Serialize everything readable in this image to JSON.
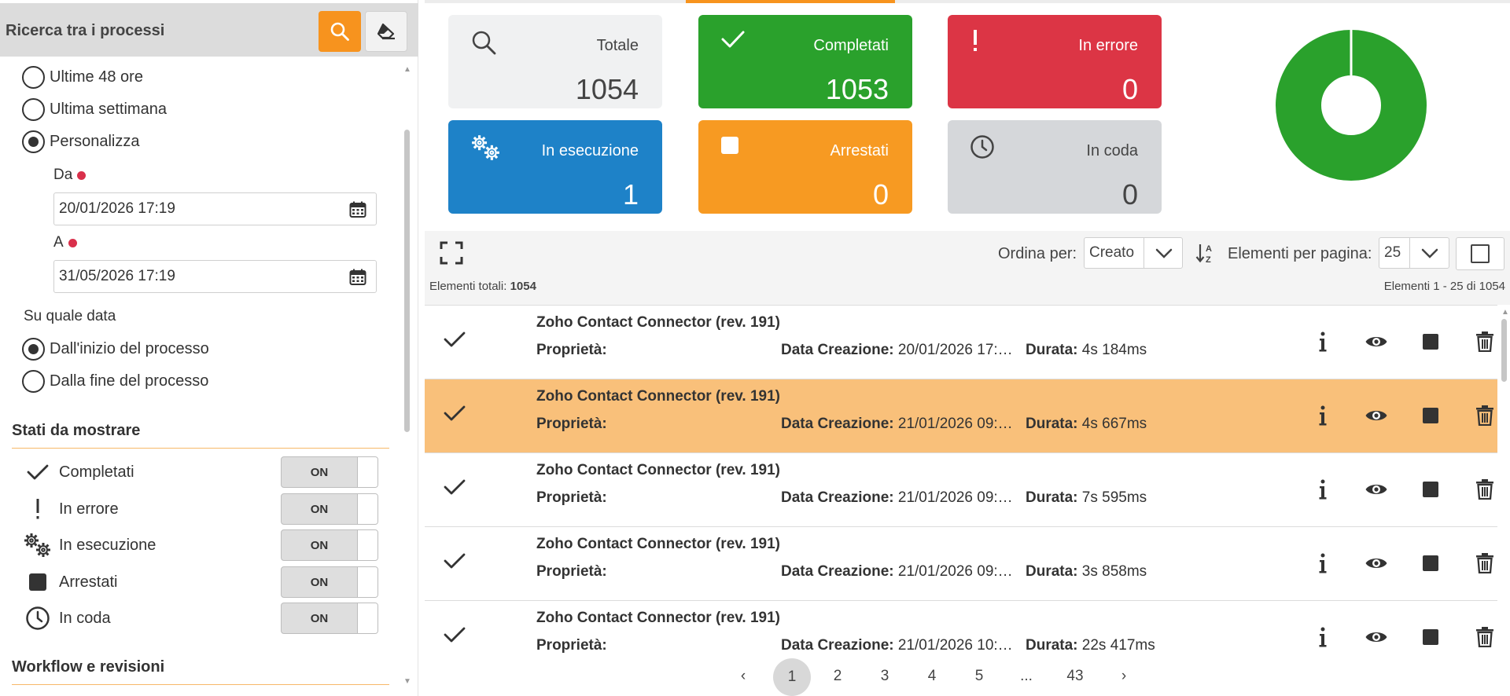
{
  "sidebar": {
    "title": "Ricerca tra i processi",
    "time_options": [
      {
        "label": "Ultime 48 ore",
        "selected": false
      },
      {
        "label": "Ultima settimana",
        "selected": false
      },
      {
        "label": "Personalizza",
        "selected": true
      }
    ],
    "from_label": "Da",
    "from_value": "20/01/2026 17:19",
    "to_label": "A",
    "to_value": "31/05/2026 17:19",
    "date_basis_label": "Su quale data",
    "date_basis_options": [
      {
        "label": "Dall'inizio del processo",
        "selected": true
      },
      {
        "label": "Dalla fine del processo",
        "selected": false
      }
    ],
    "states_title": "Stati da mostrare",
    "states": [
      {
        "label": "Completati",
        "icon": "check-icon",
        "toggle": "ON"
      },
      {
        "label": "In errore",
        "icon": "exclamation-icon",
        "toggle": "ON"
      },
      {
        "label": "In esecuzione",
        "icon": "gears-icon",
        "toggle": "ON"
      },
      {
        "label": "Arrestati",
        "icon": "stop-square-icon",
        "toggle": "ON"
      },
      {
        "label": "In coda",
        "icon": "clock-icon",
        "toggle": "ON"
      }
    ],
    "workflow_title": "Workflow e revisioni"
  },
  "summary": {
    "cards": [
      {
        "label": "Totale",
        "value": "1054",
        "icon": "search-icon",
        "color": "#f0f1f2"
      },
      {
        "label": "Completati",
        "value": "1053",
        "icon": "check-icon",
        "color": "#2aa12c"
      },
      {
        "label": "In errore",
        "value": "0",
        "icon": "exclamation-icon",
        "color": "#dc3545"
      },
      {
        "label": "In esecuzione",
        "value": "1",
        "icon": "gears-icon",
        "color": "#1e82c8"
      },
      {
        "label": "Arrestati",
        "value": "0",
        "icon": "stop-square-icon",
        "color": "#f79a22"
      },
      {
        "label": "In coda",
        "value": "0",
        "icon": "clock-icon",
        "color": "#d5d7da"
      }
    ],
    "donut": {
      "completed": 1053,
      "running": 1,
      "color": "#2aa12c"
    }
  },
  "toolbar": {
    "sort_label": "Ordina per:",
    "sort_value": "Creato",
    "perpage_label": "Elementi per pagina:",
    "perpage_value": "25",
    "total_label": "Elementi totali:",
    "total_value": "1054",
    "range_text": "Elementi 1 - 25 di 1054"
  },
  "processes": [
    {
      "title": "Zoho Contact Connector (rev. 191)",
      "prop_label": "Proprietà:",
      "created_label": "Data Creazione:",
      "created": "20/01/2026 17:…",
      "duration_label": "Durata:",
      "duration": "4s 184ms",
      "selected": false
    },
    {
      "title": "Zoho Contact Connector (rev. 191)",
      "prop_label": "Proprietà:",
      "created_label": "Data Creazione:",
      "created": "21/01/2026 09:…",
      "duration_label": "Durata:",
      "duration": "4s 667ms",
      "selected": true
    },
    {
      "title": "Zoho Contact Connector (rev. 191)",
      "prop_label": "Proprietà:",
      "created_label": "Data Creazione:",
      "created": "21/01/2026 09:…",
      "duration_label": "Durata:",
      "duration": "7s 595ms",
      "selected": false
    },
    {
      "title": "Zoho Contact Connector (rev. 191)",
      "prop_label": "Proprietà:",
      "created_label": "Data Creazione:",
      "created": "21/01/2026 09:…",
      "duration_label": "Durata:",
      "duration": "3s 858ms",
      "selected": false
    },
    {
      "title": "Zoho Contact Connector (rev. 191)",
      "prop_label": "Proprietà:",
      "created_label": "Data Creazione:",
      "created": "21/01/2026 10:…",
      "duration_label": "Durata:",
      "duration": "22s 417ms",
      "selected": false
    }
  ],
  "pagination": {
    "prev": "‹",
    "pages": [
      "1",
      "2",
      "3",
      "4",
      "5",
      "...",
      "43"
    ],
    "active": "1",
    "next": "›"
  },
  "colors": {
    "accent": "#f7931e",
    "selected_row": "#f9c07a",
    "success": "#2aa12c",
    "error": "#dc3545",
    "running": "#1e82c8",
    "stopped": "#f79a22"
  }
}
